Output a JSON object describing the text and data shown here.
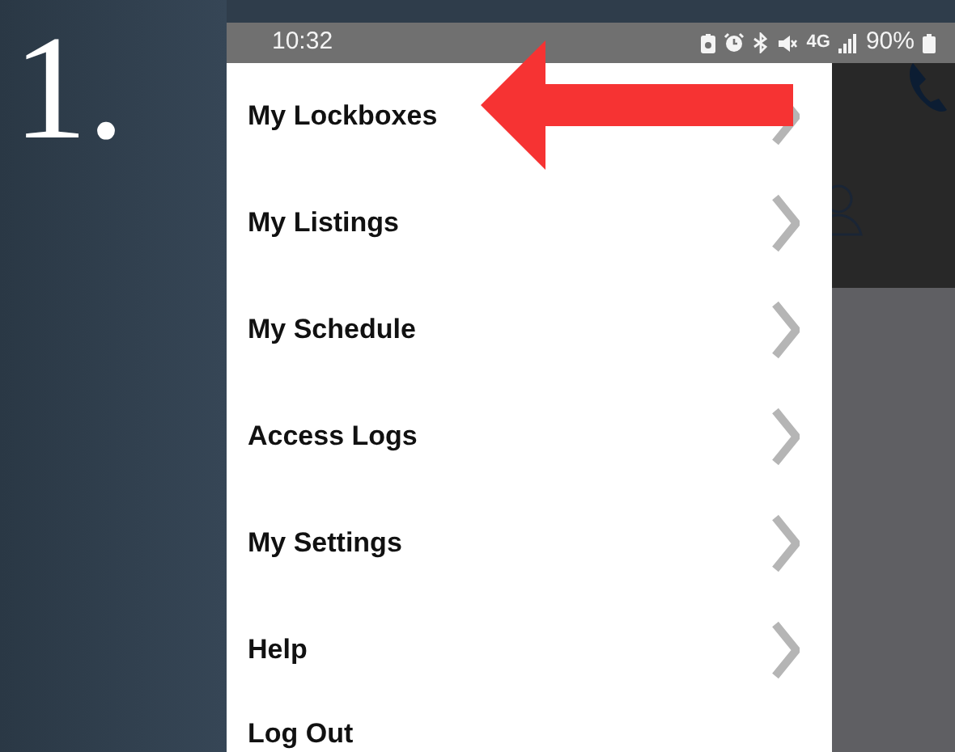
{
  "step_label": "1.",
  "status_bar": {
    "time": "10:32",
    "network": "4G",
    "battery": "90%"
  },
  "menu": {
    "items": [
      {
        "label": "My Lockboxes",
        "chevron": true
      },
      {
        "label": "My Listings",
        "chevron": true
      },
      {
        "label": "My Schedule",
        "chevron": true
      },
      {
        "label": "Access Logs",
        "chevron": true
      },
      {
        "label": "My Settings",
        "chevron": true
      },
      {
        "label": "Help",
        "chevron": true
      },
      {
        "label": "Log Out",
        "chevron": false
      }
    ]
  }
}
